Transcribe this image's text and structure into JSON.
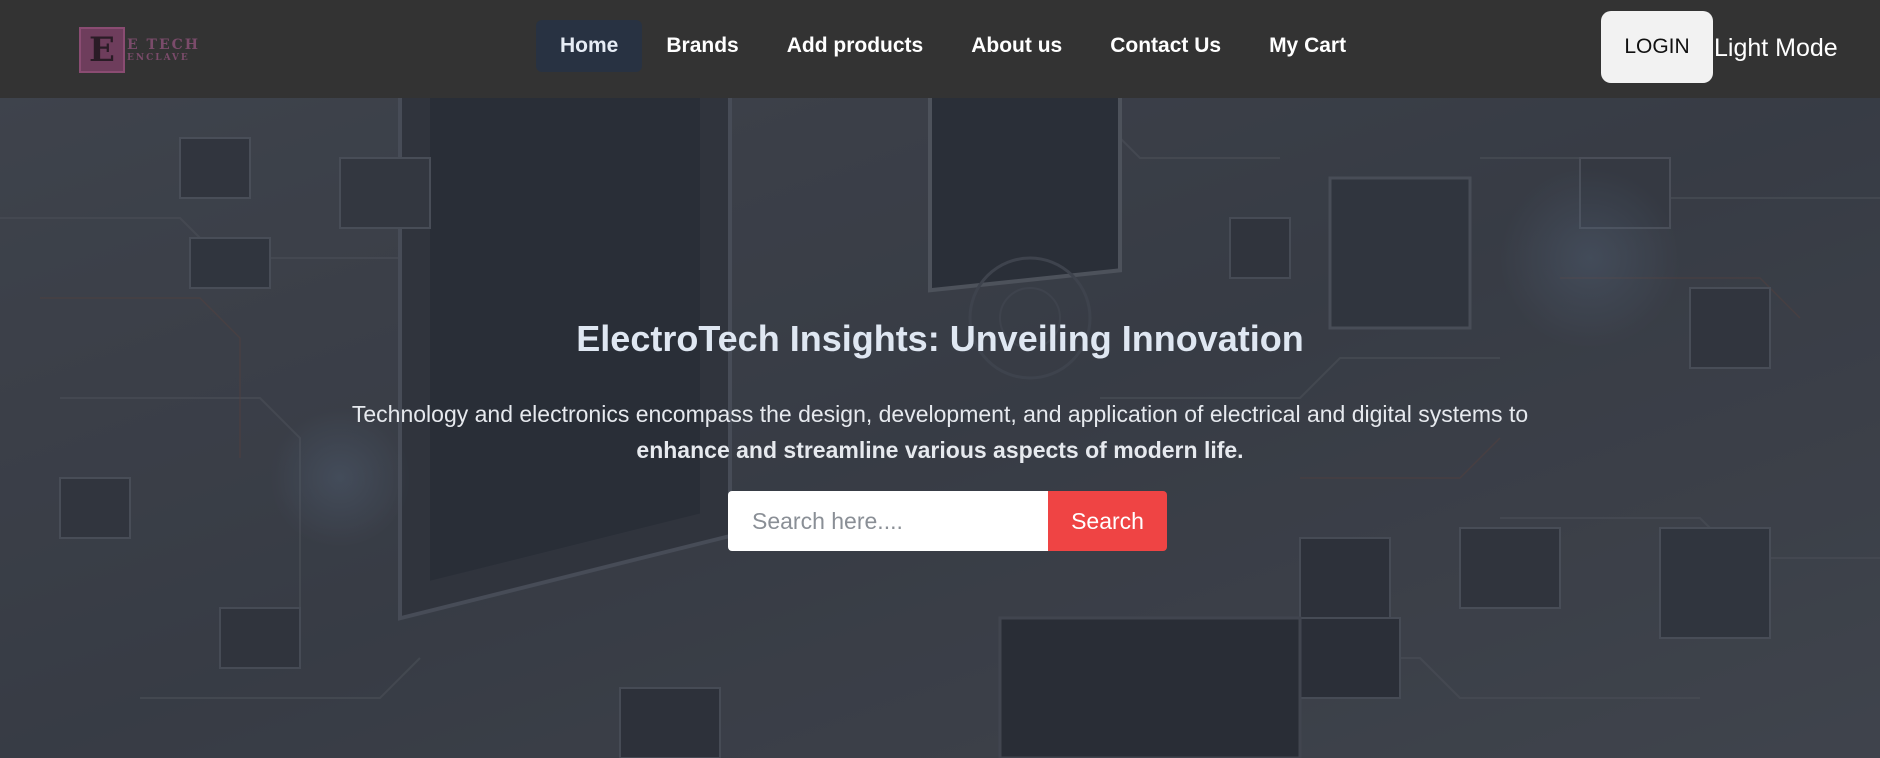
{
  "brand": {
    "logo_mark": "E",
    "logo_line1": "E TECH",
    "logo_line2": "ENCLAVE"
  },
  "nav": {
    "links": [
      {
        "label": "Home",
        "active": true
      },
      {
        "label": "Brands",
        "active": false
      },
      {
        "label": "Add products",
        "active": false
      },
      {
        "label": "About us",
        "active": false
      },
      {
        "label": "Contact Us",
        "active": false
      },
      {
        "label": "My Cart",
        "active": false
      }
    ],
    "login_label": "LOGIN",
    "mode_toggle_label": "Light Mode"
  },
  "hero": {
    "title": "ElectroTech Insights: Unveiling Innovation",
    "description_part1": "Technology and electronics encompass the design, development, and application of electrical and digital systems to",
    "description_part2": "enhance and streamline various aspects of modern life.",
    "search": {
      "placeholder": "Search here....",
      "button_label": "Search"
    }
  },
  "colors": {
    "navbar_bg": "#333333",
    "active_nav_bg": "#283242",
    "search_button": "#ef4444",
    "hero_overlay": "#282c34"
  }
}
